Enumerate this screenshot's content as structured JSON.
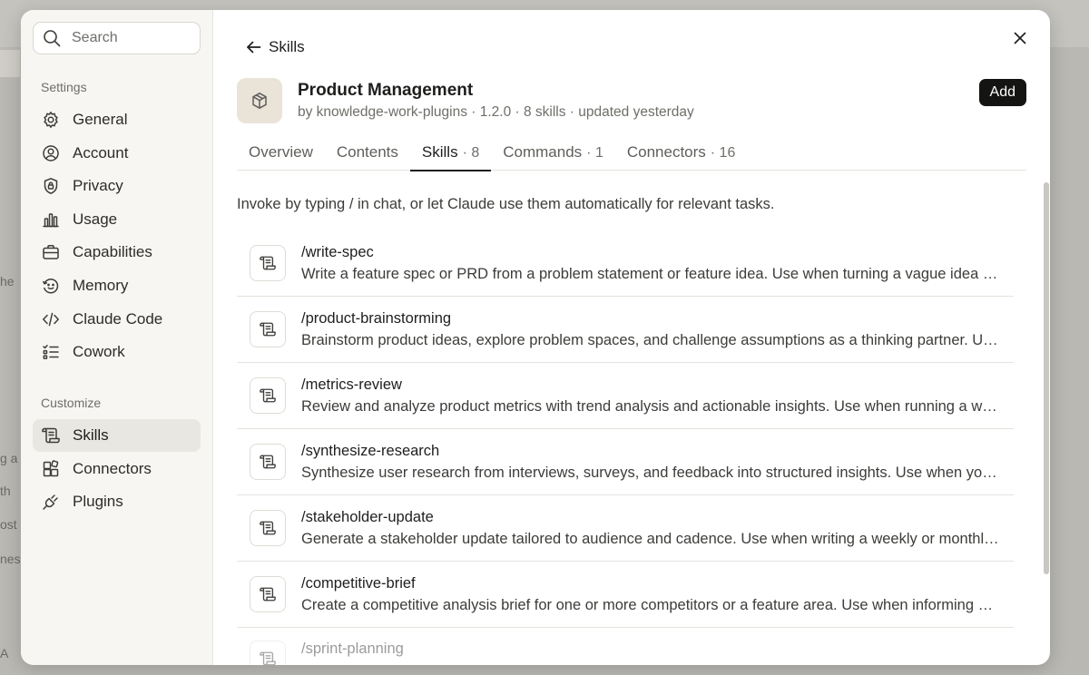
{
  "background": {
    "fragments": [
      "he",
      "g a",
      "th ",
      "ost",
      "nes",
      "A"
    ]
  },
  "sidebar": {
    "search_placeholder": "Search",
    "settings_label": "Settings",
    "settings_items": [
      {
        "label": "General",
        "icon": "gear-icon"
      },
      {
        "label": "Account",
        "icon": "user-circle-icon"
      },
      {
        "label": "Privacy",
        "icon": "shield-icon"
      },
      {
        "label": "Usage",
        "icon": "bar-chart-icon"
      },
      {
        "label": "Capabilities",
        "icon": "briefcase-icon"
      },
      {
        "label": "Memory",
        "icon": "memory-icon"
      },
      {
        "label": "Claude Code",
        "icon": "code-icon"
      },
      {
        "label": "Cowork",
        "icon": "checklist-icon"
      }
    ],
    "customize_label": "Customize",
    "customize_items": [
      {
        "label": "Skills",
        "icon": "scroll-icon",
        "active": true
      },
      {
        "label": "Connectors",
        "icon": "blocks-icon"
      },
      {
        "label": "Plugins",
        "icon": "plug-icon"
      }
    ]
  },
  "main": {
    "back_label": "Skills",
    "plugin": {
      "title": "Product Management",
      "meta": "by knowledge-work-plugins · 1.2.0 · 8 skills · updated yesterday",
      "add_label": "Add"
    },
    "tabs": [
      {
        "label": "Overview",
        "count": ""
      },
      {
        "label": "Contents",
        "count": ""
      },
      {
        "label": "Skills",
        "count": "· 8",
        "active": true
      },
      {
        "label": "Commands",
        "count": "· 1"
      },
      {
        "label": "Connectors",
        "count": "· 16"
      }
    ],
    "intro": "Invoke by typing / in chat, or let Claude use them automatically for relevant tasks.",
    "skills": [
      {
        "name": "/write-spec",
        "desc": "Write a feature spec or PRD from a problem statement or feature idea. Use when turning a vague idea or request into a structured spec"
      },
      {
        "name": "/product-brainstorming",
        "desc": "Brainstorm product ideas, explore problem spaces, and challenge assumptions as a thinking partner. Use when exploring"
      },
      {
        "name": "/metrics-review",
        "desc": "Review and analyze product metrics with trend analysis and actionable insights. Use when running a weekly review"
      },
      {
        "name": "/synthesize-research",
        "desc": "Synthesize user research from interviews, surveys, and feedback into structured insights. Use when you have"
      },
      {
        "name": "/stakeholder-update",
        "desc": "Generate a stakeholder update tailored to audience and cadence. Use when writing a weekly or monthly update"
      },
      {
        "name": "/competitive-brief",
        "desc": "Create a competitive analysis brief for one or more competitors or a feature area. Use when informing product strategy"
      },
      {
        "name": "/sprint-planning",
        "desc": ""
      }
    ]
  }
}
